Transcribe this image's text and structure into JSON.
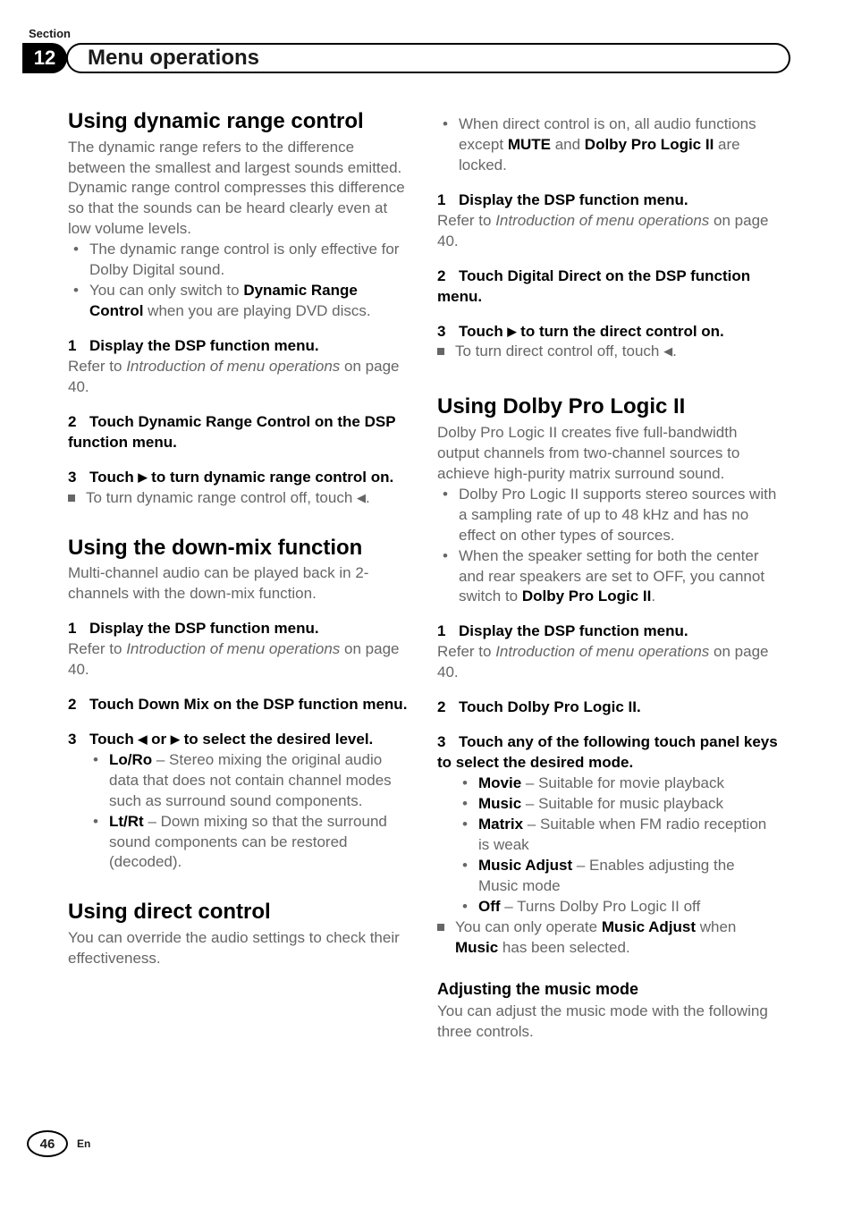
{
  "header": {
    "section_label": "Section",
    "section_number": "12",
    "title": "Menu operations"
  },
  "col1": {
    "s1": {
      "heading": "Using dynamic range control",
      "intro": "The dynamic range refers to the difference between the smallest and largest sounds emitted. Dynamic range control compresses this difference so that the sounds can be heard clearly even at low volume levels.",
      "bullets": [
        "The dynamic range control is only effective for Dolby Digital sound.",
        {
          "pre": "You can only switch to ",
          "bold": "Dynamic Range Control",
          "post": " when you are playing DVD discs."
        }
      ],
      "step1": "Display the DSP function menu.",
      "step1_after_pre": "Refer to ",
      "step1_after_it": "Introduction of menu operations",
      "step1_after_post": " on page 40.",
      "step2": "Touch Dynamic Range Control on the DSP function menu.",
      "step3_pre": "Touch ",
      "step3_post": " to turn dynamic range control on.",
      "step3_note_pre": "To turn dynamic range control off, touch ",
      "step3_note_post": "."
    },
    "s2": {
      "heading": "Using the down-mix function",
      "intro": "Multi-channel audio can be played back in 2-channels with the down-mix function.",
      "step1": "Display the DSP function menu.",
      "step1_after_pre": "Refer to ",
      "step1_after_it": "Introduction of menu operations",
      "step1_after_post": " on page 40.",
      "step2": "Touch Down Mix on the DSP function menu.",
      "step3_pre": "Touch ",
      "step3_mid": " or ",
      "step3_post": " to select the desired level.",
      "opts": [
        {
          "bold": "Lo/Ro",
          "text": " – Stereo mixing the original audio data that does not contain channel modes such as surround sound components."
        },
        {
          "bold": "Lt/Rt",
          "text": " – Down mixing so that the surround sound components can be restored (decoded)."
        }
      ]
    },
    "s3": {
      "heading": "Using direct control",
      "intro": "You can override the audio settings to check their effectiveness."
    }
  },
  "col2": {
    "top_bullet_pre": "When direct control is on, all audio functions except ",
    "top_bullet_b1": "MUTE",
    "top_bullet_mid": " and ",
    "top_bullet_b2": "Dolby Pro Logic II",
    "top_bullet_post": " are locked.",
    "step1": "Display the DSP function menu.",
    "step1_after_pre": "Refer to ",
    "step1_after_it": "Introduction of menu operations",
    "step1_after_post": " on page 40.",
    "step2": "Touch Digital Direct on the DSP function menu.",
    "step3_pre": "Touch ",
    "step3_post": " to turn the direct control on.",
    "step3_note_pre": "To turn direct control off, touch ",
    "step3_note_post": ".",
    "s4": {
      "heading": "Using Dolby Pro Logic II",
      "intro": "Dolby Pro Logic II creates five full-bandwidth output channels from two-channel sources to achieve high-purity matrix surround sound.",
      "bullets": [
        "Dolby Pro Logic II supports stereo sources with a sampling rate of up to 48 kHz and has no effect on other types of sources.",
        {
          "pre": "When the speaker setting for both the center and rear speakers are set to OFF, you cannot switch to ",
          "bold": "Dolby Pro Logic II",
          "post": "."
        }
      ],
      "step1": "Display the DSP function menu.",
      "step1_after_pre": "Refer to ",
      "step1_after_it": "Introduction of menu operations",
      "step1_after_post": " on page 40.",
      "step2": "Touch Dolby Pro Logic II.",
      "step3": "Touch any of the following touch panel keys to select the desired mode.",
      "modes": [
        {
          "bold": "Movie",
          "text": " – Suitable for movie playback"
        },
        {
          "bold": "Music",
          "text": " – Suitable for music playback"
        },
        {
          "bold": "Matrix",
          "text": " – Suitable when FM radio reception is weak"
        },
        {
          "bold": "Music Adjust",
          "text": " – Enables adjusting the Music mode"
        },
        {
          "bold": "Off",
          "text": " – Turns Dolby Pro Logic II off"
        }
      ],
      "note_pre": "You can only operate ",
      "note_b1": "Music Adjust",
      "note_mid": " when ",
      "note_b2": "Music",
      "note_post": " has been selected.",
      "sub_heading": "Adjusting the music mode",
      "sub_text": "You can adjust the music mode with the following three controls."
    }
  },
  "footer": {
    "page_number": "46",
    "lang": "En"
  }
}
